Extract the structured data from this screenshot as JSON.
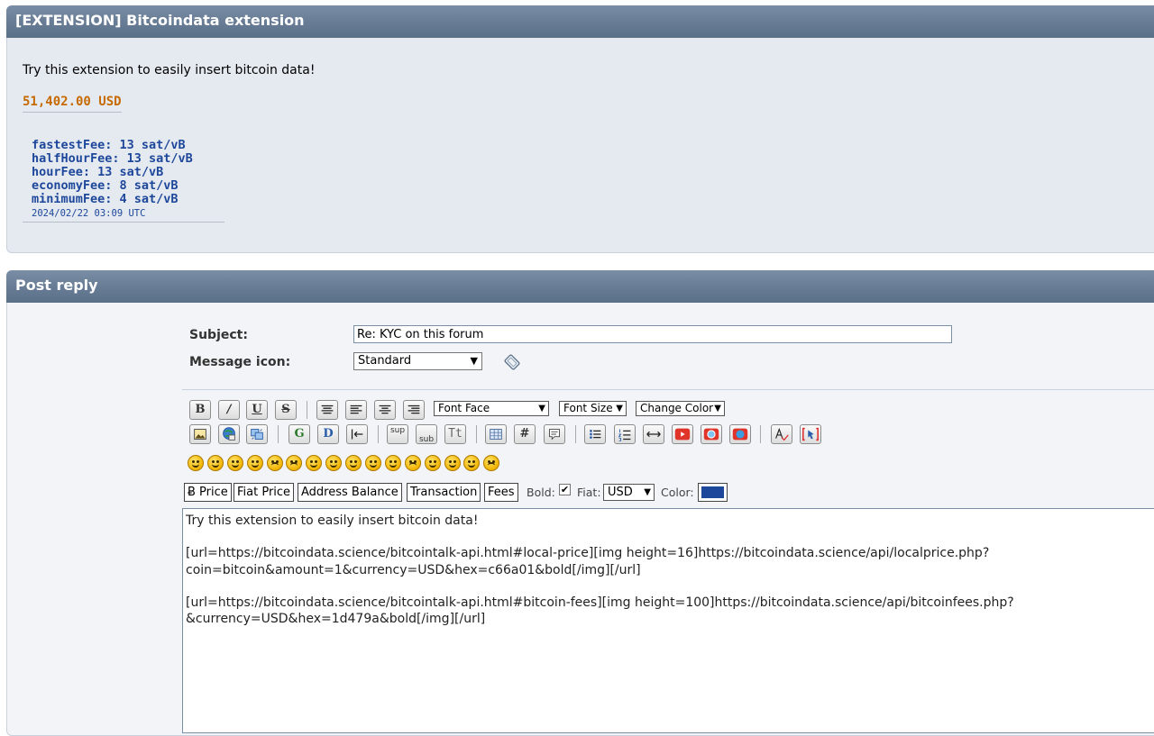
{
  "extension_panel": {
    "title": "[EXTENSION] Bitcoindata extension",
    "intro": "Try this extension to easily insert bitcoin data!",
    "price_text": "51,402.00 USD",
    "fees": [
      "fastestFee: 13 sat/vB",
      "halfHourFee: 13 sat/vB",
      "hourFee: 13 sat/vB",
      "economyFee: 8 sat/vB",
      "minimumFee: 4 sat/vB"
    ],
    "fees_timestamp": "2024/02/22 03:09 UTC"
  },
  "post_reply": {
    "title": "Post reply",
    "subject_label": "Subject:",
    "subject_value": "Re: KYC on this forum",
    "message_icon_label": "Message icon:",
    "message_icon_selected": "Standard",
    "font_face": "Font Face",
    "font_size": "Font Size",
    "change_color": "Change Color",
    "toolbar_row1": {
      "bold": "B",
      "italic": "/",
      "underline": "U",
      "strike": "S"
    },
    "toolbar_row2": {
      "sup": "sup",
      "sub": "sub",
      "teletype": "Tt",
      "hash": "#",
      "g": "G",
      "d": "D"
    },
    "bitcoindata_bar": {
      "buttons": [
        "Ƀ Price",
        "Fiat Price",
        "Address Balance",
        "Transaction",
        "Fees"
      ],
      "bold_label": "Bold:",
      "bold_checked": "✔",
      "fiat_label": "Fiat:",
      "fiat_selected": "USD",
      "color_label": "Color:",
      "color_value": "#1d479a"
    },
    "message_text": "Try this extension to easily insert bitcoin data!\n\n[url=https://bitcoindata.science/bitcointalk-api.html#local-price][img height=16]https://bitcoindata.science/api/localprice.php?\ncoin=bitcoin&amount=1&currency=USD&hex=c66a01&bold[/img][/url]\n\n[url=https://bitcoindata.science/bitcointalk-api.html#bitcoin-fees][img height=100]https://bitcoindata.science/api/bitcoinfees.php?\n&currency=USD&hex=1d479a&bold[/img][/url]"
  },
  "colors": {
    "price": "#c66a01",
    "fees": "#1d479a",
    "header": "#6a7f97",
    "panel_bg": "#e5e9f0"
  }
}
